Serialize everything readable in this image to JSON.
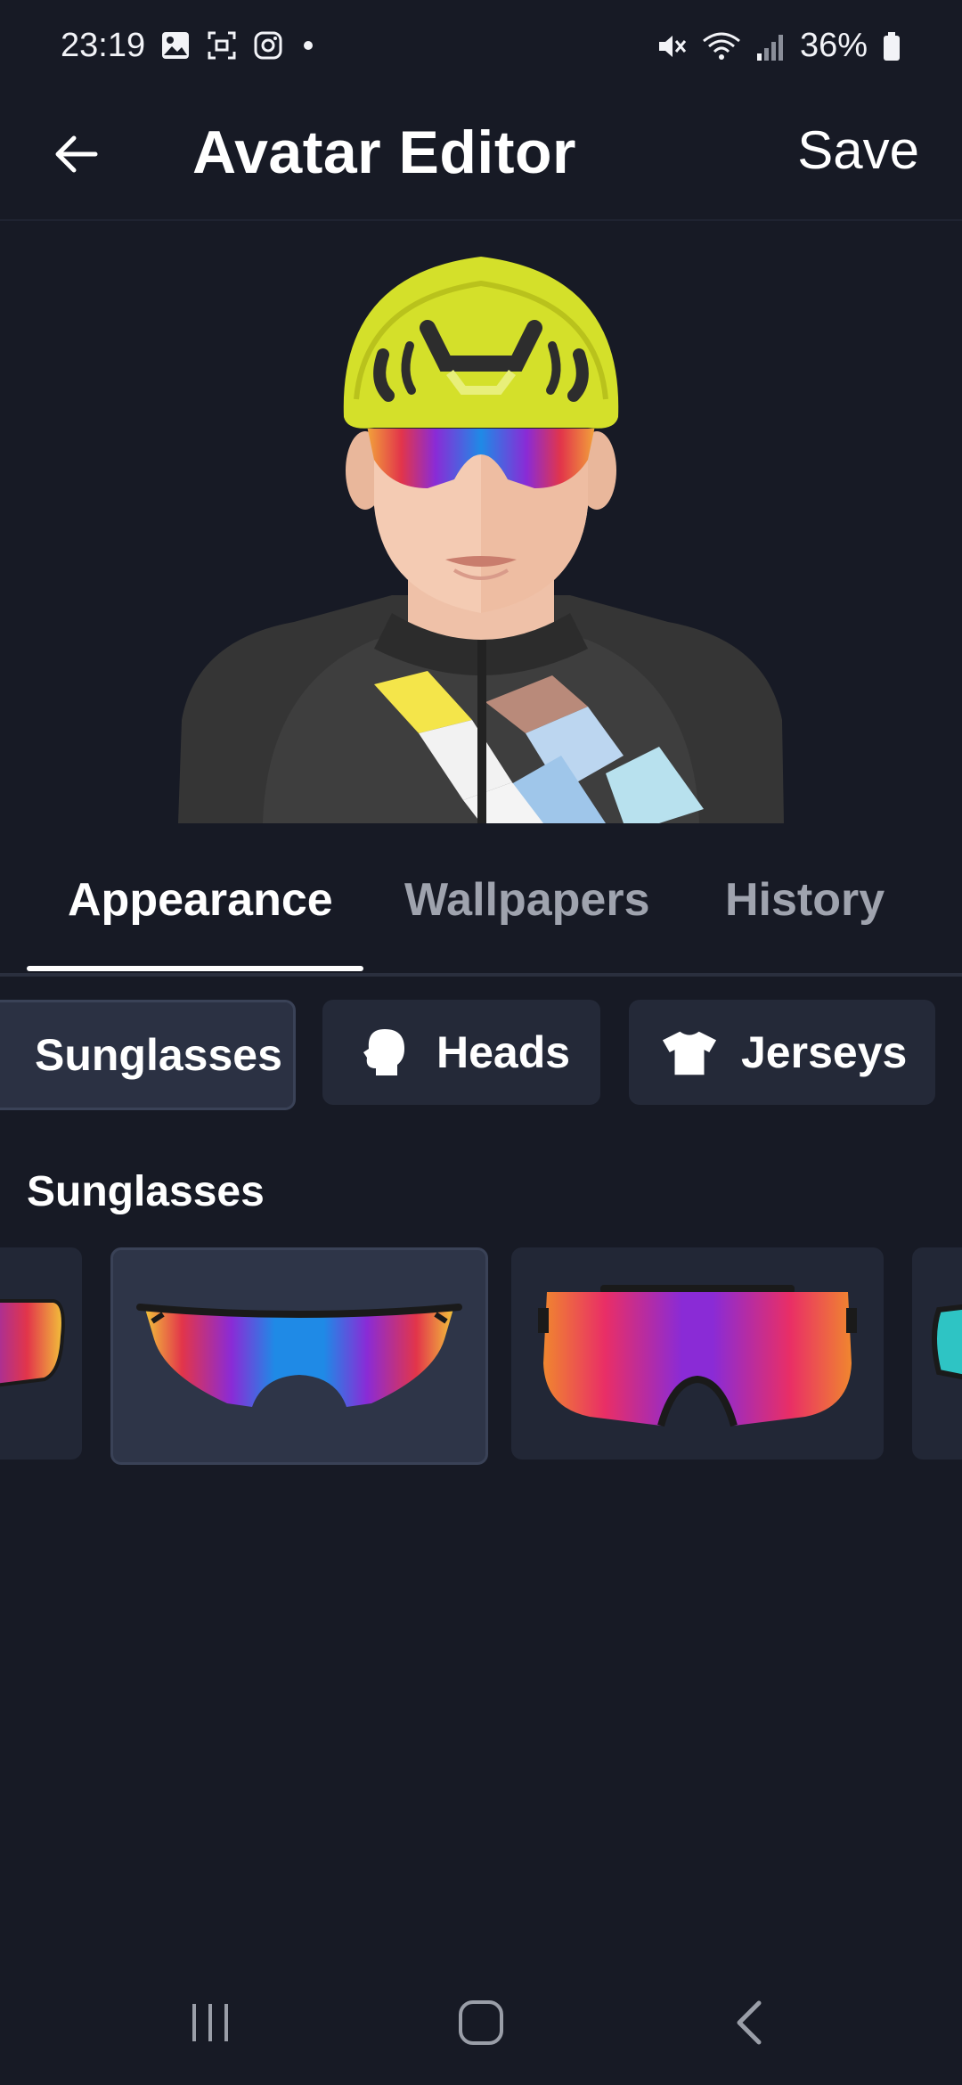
{
  "status": {
    "time": "23:19",
    "battery": "36%"
  },
  "appbar": {
    "title": "Avatar Editor",
    "save_label": "Save"
  },
  "tabs": [
    {
      "label": "Appearance",
      "active": true
    },
    {
      "label": "Wallpapers",
      "active": false
    },
    {
      "label": "History",
      "active": false
    }
  ],
  "chips": [
    {
      "label": "Sunglasses",
      "icon": "sunglasses-icon",
      "selected": true
    },
    {
      "label": "Heads",
      "icon": "head-icon",
      "selected": false
    },
    {
      "label": "Jerseys",
      "icon": "jersey-icon",
      "selected": false
    }
  ],
  "section": {
    "title": "Sunglasses"
  },
  "options": [
    {
      "name": "sunglasses-option-1",
      "selected": false
    },
    {
      "name": "sunglasses-option-2",
      "selected": true
    },
    {
      "name": "sunglasses-option-3",
      "selected": false
    },
    {
      "name": "sunglasses-option-4",
      "selected": false
    }
  ],
  "colors": {
    "background": "#171a25",
    "chip": "#242938",
    "card": "#222736",
    "helmet": "#d4e02a"
  }
}
